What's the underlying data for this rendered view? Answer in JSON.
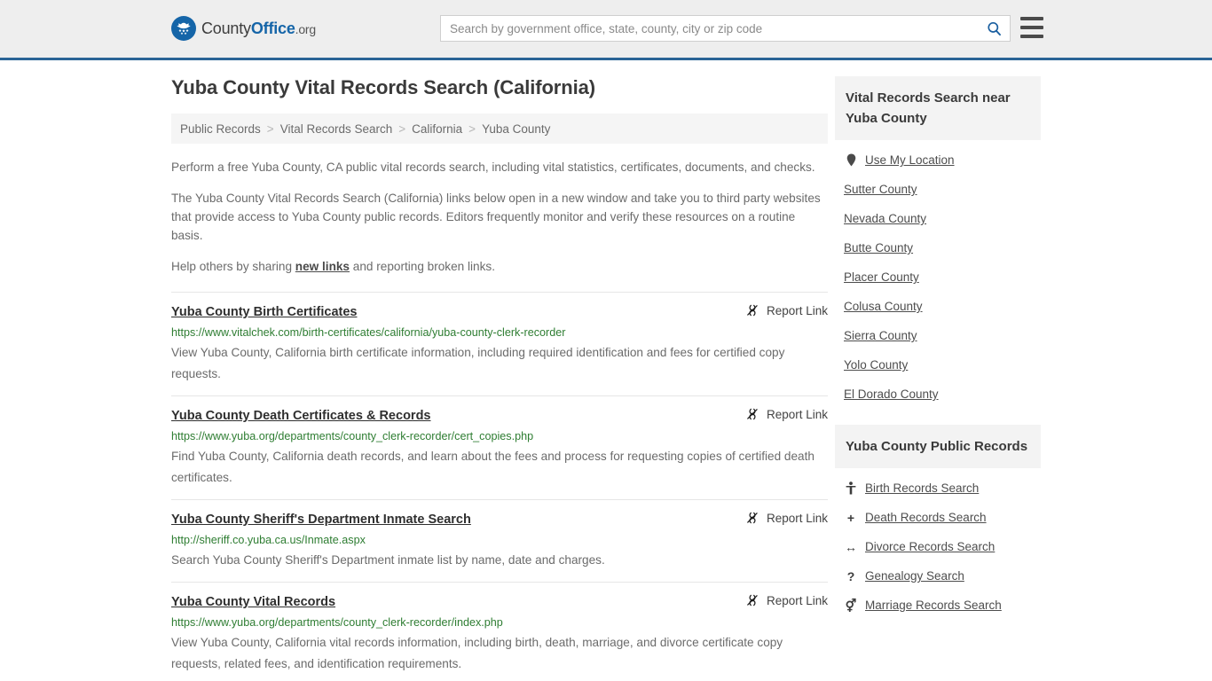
{
  "header": {
    "logo_text_county": "County",
    "logo_text_office": "Office",
    "logo_text_tld": ".org",
    "logo_icon": "eagle-seal-icon",
    "search_placeholder": "Search by government office, state, county, city or zip code",
    "search_value": "",
    "search_icon": "search-icon",
    "menu_icon": "hamburger-menu-icon"
  },
  "page": {
    "title": "Yuba County Vital Records Search (California)"
  },
  "breadcrumb": {
    "separator": ">",
    "items": [
      {
        "label": "Public Records"
      },
      {
        "label": "Vital Records Search"
      },
      {
        "label": "California"
      },
      {
        "label": "Yuba County"
      }
    ]
  },
  "intro": {
    "paragraph1": "Perform a free Yuba County, CA public vital records search, including vital statistics, certificates, documents, and checks.",
    "paragraph2": "The Yuba County Vital Records Search (California) links below open in a new window and take you to third party websites that provide access to Yuba County public records. Editors frequently monitor and verify these resources on a routine basis.",
    "paragraph3_before": "Help others by sharing ",
    "paragraph3_link": "new links",
    "paragraph3_after": " and reporting broken links."
  },
  "report_link_label": "Report Link",
  "report_link_icon": "broken-chain-icon",
  "results": [
    {
      "title": "Yuba County Birth Certificates",
      "url": "https://www.vitalchek.com/birth-certificates/california/yuba-county-clerk-recorder",
      "description": "View Yuba County, California birth certificate information, including required identification and fees for certified copy requests."
    },
    {
      "title": "Yuba County Death Certificates & Records",
      "url": "https://www.yuba.org/departments/county_clerk-recorder/cert_copies.php",
      "description": "Find Yuba County, California death records, and learn about the fees and process for requesting copies of certified death certificates."
    },
    {
      "title": "Yuba County Sheriff's Department Inmate Search",
      "url": "http://sheriff.co.yuba.ca.us/Inmate.aspx",
      "description": "Search Yuba County Sheriff's Department inmate list by name, date and charges."
    },
    {
      "title": "Yuba County Vital Records",
      "url": "https://www.yuba.org/departments/county_clerk-recorder/index.php",
      "description": "View Yuba County, California vital records information, including birth, death, marriage, and divorce certificate copy requests, related fees, and identification requirements."
    }
  ],
  "sidebar": {
    "nearby": {
      "title": "Vital Records Search near Yuba County",
      "items": [
        {
          "label": "Use My Location",
          "icon": "map-pin-icon"
        },
        {
          "label": "Sutter County",
          "icon": ""
        },
        {
          "label": "Nevada County",
          "icon": ""
        },
        {
          "label": "Butte County",
          "icon": ""
        },
        {
          "label": "Placer County",
          "icon": ""
        },
        {
          "label": "Colusa County",
          "icon": ""
        },
        {
          "label": "Sierra County",
          "icon": ""
        },
        {
          "label": "Yolo County",
          "icon": ""
        },
        {
          "label": "El Dorado County",
          "icon": ""
        }
      ]
    },
    "public_records": {
      "title": "Yuba County Public Records",
      "items": [
        {
          "label": "Birth Records Search",
          "icon": "baby-icon",
          "glyph": "὇6"
        },
        {
          "label": "Death Records Search",
          "icon": "cross-icon",
          "glyph": "+"
        },
        {
          "label": "Divorce Records Search",
          "icon": "left-right-arrow-icon",
          "glyph": "↔"
        },
        {
          "label": "Genealogy Search",
          "icon": "question-mark-icon",
          "glyph": "?"
        },
        {
          "label": "Marriage Records Search",
          "icon": "male-female-icon",
          "glyph": "⚥"
        }
      ]
    }
  },
  "colors": {
    "header_bg": "#eeeeee",
    "header_border": "#2a6496",
    "brand_blue": "#1565a8",
    "url_green": "#2e7d32",
    "panel_bg": "#f3f3f3"
  }
}
